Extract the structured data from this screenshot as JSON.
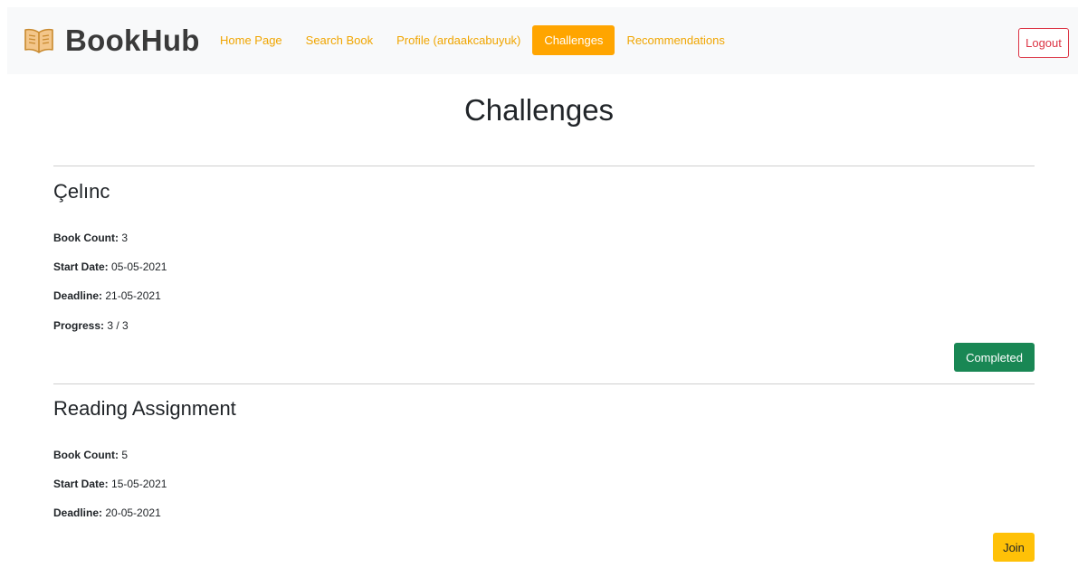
{
  "brand": {
    "name": "BookHub",
    "icon": "open-book-icon"
  },
  "nav": {
    "links": [
      {
        "label": "Home Page"
      },
      {
        "label": "Search Book"
      },
      {
        "label": "Profile (ardaakcabuyuk)"
      },
      {
        "label": "Challenges",
        "active": true
      },
      {
        "label": "Recommendations"
      }
    ],
    "logout_label": "Logout"
  },
  "page": {
    "title": "Challenges"
  },
  "challenges": [
    {
      "name": "Çelınc",
      "book_count_label": "Book Count:",
      "book_count": "3",
      "start_date_label": "Start Date:",
      "start_date": "05-05-2021",
      "deadline_label": "Deadline:",
      "deadline": "21-05-2021",
      "progress_label": "Progress:",
      "progress": "3 / 3",
      "action_label": "Completed"
    },
    {
      "name": "Reading Assignment",
      "book_count_label": "Book Count:",
      "book_count": "5",
      "start_date_label": "Start Date:",
      "start_date": "15-05-2021",
      "deadline_label": "Deadline:",
      "deadline": "20-05-2021",
      "action_label": "Join"
    }
  ],
  "colors": {
    "accent": "#ffa500",
    "link": "#f0a500",
    "logout": "#dc3545",
    "completed": "#198754",
    "join": "#ffc107"
  }
}
